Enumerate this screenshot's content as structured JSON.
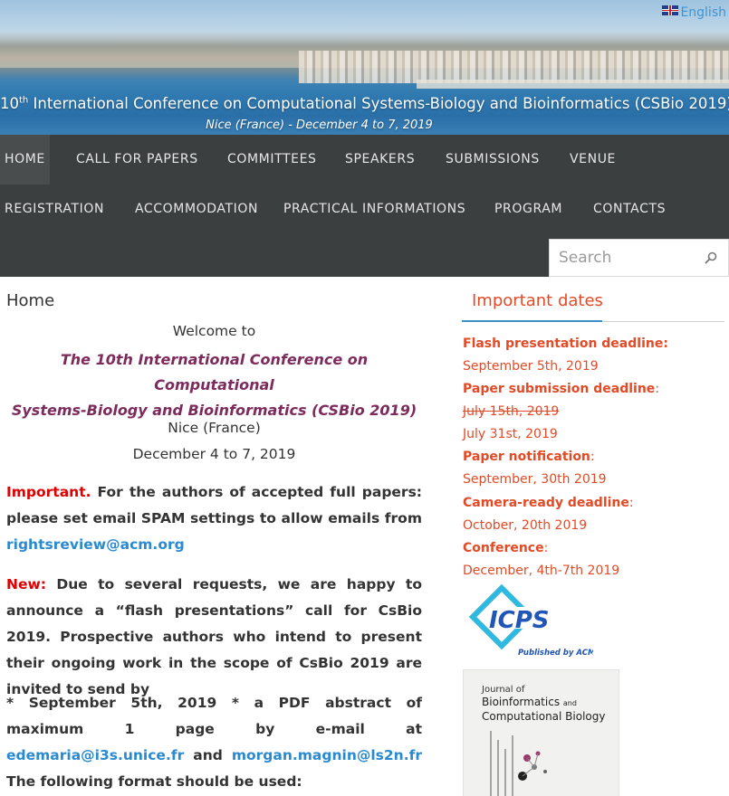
{
  "header": {
    "title_num": "10",
    "title_sup": "th",
    "title_rest": " International Conference on Computational Systems-Biology and Bioinformatics (CSBio 2019)",
    "subtitle": "Nice (France) - December 4 to 7, 2019",
    "language": "English"
  },
  "nav": {
    "items": [
      "HOME",
      "CALL FOR PAPERS",
      "COMMITTEES",
      "SPEAKERS",
      "SUBMISSIONS",
      "VENUE",
      "REGISTRATION",
      "ACCOMMODATION",
      "PRACTICAL INFORMATIONS",
      "PROGRAM",
      "CONTACTS"
    ],
    "active": "HOME",
    "search_placeholder": "Search"
  },
  "main": {
    "page_title": "Home",
    "welcome": "Welcome to",
    "conference_line1": "The 10th International Conference on Computational",
    "conference_line2": "Systems-Biology and Bioinformatics (CSBio 2019)",
    "place": "Nice (France)",
    "dates": "December 4 to 7, 2019",
    "important_label": "Important.",
    "important_text": " For the authors of accepted full papers: please set email SPAM settings to allow emails from ",
    "important_email": "rightsreview@acm.org",
    "new_label": "New:",
    "new_text": " Due to several requests, we are happy to announce a “flash presentations” call for CsBio 2019. Prospective authors who intend to present their ongoing work in the scope of CsBio 2019 are invited to send by",
    "deadline_text": "* September 5th, 2019 *  a PDF abstract of maximum 1 page by e-mail at ",
    "email_1": "edemaria@i3s.unice.fr",
    "and": " and ",
    "email_2": "morgan.magnin@ls2n.fr",
    "format_text": " The following format should be used:"
  },
  "sidebar": {
    "title": "Important dates",
    "flash_label": "Flash presentation deadline:",
    "flash_date": "September 5th, 2019",
    "paper_label": "Paper submission deadline",
    "paper_old_date": "July 15th, 2019",
    "paper_new_date": "July 31st, 2019",
    "notification_label": "Paper notification",
    "notification_date": "September, 30th 2019",
    "camera_label": "Camera-ready deadline",
    "camera_date": "October, 20th 2019",
    "conference_label": "Conference",
    "conference_date": "December, 4th-7th 2019",
    "colon": ":",
    "icps_text": "ICPS",
    "icps_sub": "Published by ACM",
    "journal_line1": "Journal of",
    "journal_line2": "Bioinformatics",
    "journal_and": "and",
    "journal_line3": "Computational Biology"
  },
  "colors": {
    "nav_bg": "#3c3f40",
    "accent_red": "#e34a26",
    "link_blue": "#2a8ad0",
    "conference_purple": "#7d2a5c"
  }
}
